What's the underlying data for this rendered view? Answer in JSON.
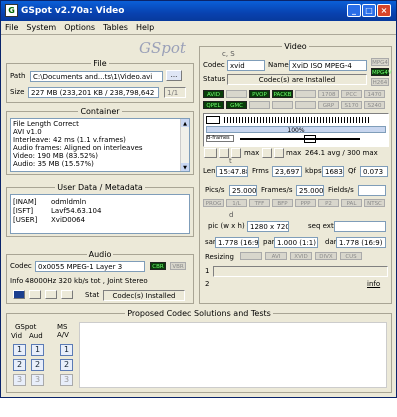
{
  "window": {
    "title": "GSpot v2.70a: Video",
    "icon": "G",
    "buttons": [
      "_",
      "□",
      "×"
    ]
  },
  "menu": [
    "File",
    "System",
    "Options",
    "Tables",
    "Help"
  ],
  "logo": "GSpot",
  "file": {
    "title": "File",
    "path_label": "Path",
    "path_value": "C:\\Documents and...ts\\1\\Video.avi",
    "browse": "...",
    "size_label": "Size",
    "size_value": "227 MB (233,201 KB / 238,798,642",
    "page": "1/1"
  },
  "container": {
    "title": "Container",
    "lines": [
      "File Length Correct",
      "AVI v1.0",
      "Interleave: 42 ms (1.1 v.frames)",
      "Audio frames: Aligned on interleaves",
      "Video: 190 MB (83.52%)",
      "Audio: 35 MB (15.57%)"
    ]
  },
  "userdata": {
    "title": "User Data / Metadata",
    "rows": [
      {
        "key": "[INAM]",
        "val": "odmldmln"
      },
      {
        "key": "[ISFT]",
        "val": "Lavf54.63.104"
      },
      {
        "key": "[USER]",
        "val": "XviD0064"
      }
    ]
  },
  "audio": {
    "title": "Audio",
    "codec_label": "Codec",
    "codec_value": "0x0055 MPEG-1 Layer 3",
    "badges": [
      "CBR",
      "VBR"
    ],
    "info_label": "Info",
    "info_value": "48000Hz  320 kb/s tot , Joint Stereo",
    "stat_label": "Stat",
    "stat_value": "Codec(s) Installed"
  },
  "video": {
    "title": "Video",
    "cs": "c, S",
    "codec_label": "Codec",
    "codec_value": "xvid",
    "name_label": "Name",
    "name_value": "XviD ISO MPEG-4",
    "status_label": "Status",
    "status_value": "Codec(s) are Installed",
    "side_badges": [
      "MPG4",
      "MPG4V",
      "H264"
    ],
    "flags_row1": [
      {
        "t": "AVID",
        "on": true
      },
      {
        "t": "",
        "on": false
      },
      {
        "t": "PVOP",
        "on": true
      },
      {
        "t": "PACKB",
        "on": true
      },
      {
        "t": "",
        "on": false
      },
      {
        "t": "1708",
        "on": false
      },
      {
        "t": "PCC",
        "on": false
      },
      {
        "t": "1470",
        "on": false
      }
    ],
    "flags_row2": [
      {
        "t": "QPEL",
        "on": true
      },
      {
        "t": "GMC",
        "on": true
      },
      {
        "t": "",
        "on": false
      },
      {
        "t": "",
        "on": false
      },
      {
        "t": "",
        "on": false
      },
      {
        "t": "GRP",
        "on": false
      },
      {
        "t": "S170",
        "on": false
      },
      {
        "t": "S240",
        "on": false
      }
    ],
    "progress": "100%",
    "bframes": "B-frames",
    "kbps_value": "264.1 avg / 300 max",
    "max1": "max",
    "max2": "max",
    "t_label": "t",
    "len_label": "Len",
    "len_value": "15:47.880",
    "frms_label": "Frms",
    "frms_value": "23,697",
    "kbps_label": "kbps",
    "kbps": "1683",
    "q_label": "Qf",
    "q_value": "0.073",
    "pics_label": "Pics/s",
    "pics_value": "25.000",
    "frames_label": "Frames/s",
    "frames_value": "25.000",
    "fields_label": "Fields/s",
    "fields_value": "",
    "t_badges": [
      "PROG",
      "1/L",
      "TFF",
      "BFP",
      "PPP",
      "P2",
      "PAL",
      "NTSC"
    ],
    "d_label": "d",
    "pic_label": "pic (w x h)",
    "pic_value": "1280 x 720",
    "seq_label": "seq ext",
    "seq_value": "",
    "sar_label": "sar",
    "sar_value": "1.778 (16:9)",
    "par_label": "par",
    "par_value": "1.000 (1:1)",
    "dar_label": "dar",
    "dar_value": "1.778 (16:9)",
    "resizing_label": "Resizing",
    "resize_badges": [
      "",
      "AVI",
      "XVID",
      "DIVX",
      "CUS"
    ],
    "row1": "1",
    "row2": "2",
    "info_link": "info"
  },
  "proposed": {
    "title": "Proposed Codec Solutions and Tests",
    "gspot_label": "GSpot",
    "vid_label": "Vid",
    "aud_label": "Aud",
    "ms_label": "MS A/V",
    "rows": [
      "1",
      "2",
      "3"
    ]
  }
}
